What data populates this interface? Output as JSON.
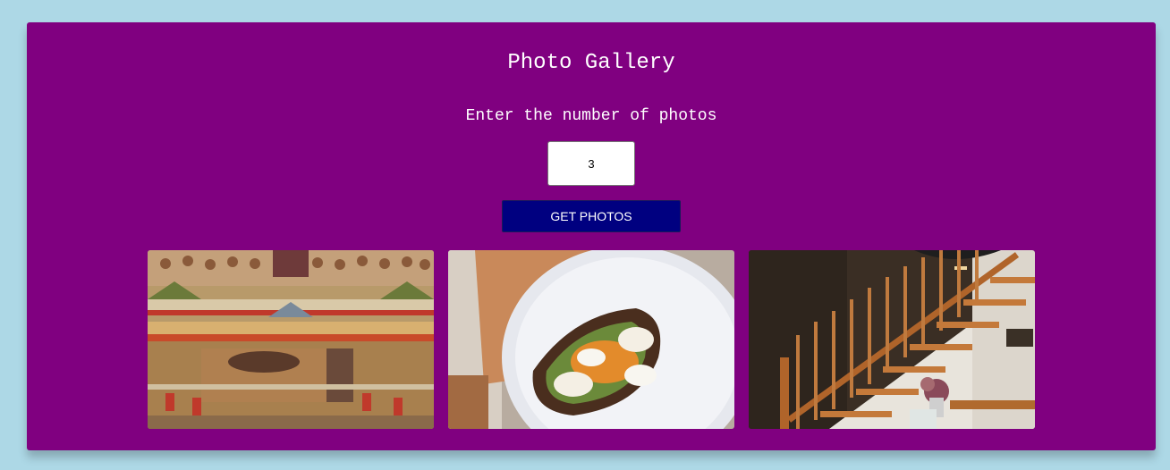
{
  "title": "Photo Gallery",
  "prompt": "Enter the number of photos",
  "photo_count": "3",
  "button_label": "GET PHOTOS",
  "photos": [
    {
      "subject": "painting-court-scene"
    },
    {
      "subject": "plate-with-toast"
    },
    {
      "subject": "wooden-staircase"
    }
  ],
  "colors": {
    "page_background": "#add8e6",
    "card_background": "#800080",
    "button_background": "#000080",
    "text": "#ffffff"
  }
}
